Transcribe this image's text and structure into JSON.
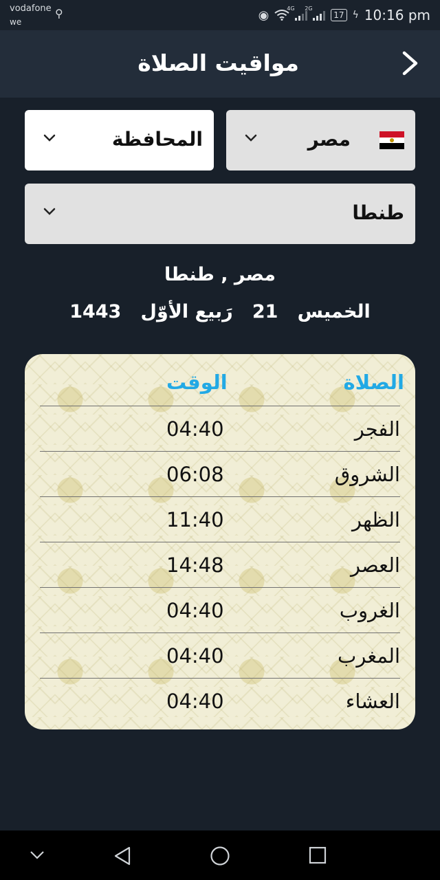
{
  "status": {
    "carrier": "vodafone",
    "carrier2": "we",
    "network1": "4G",
    "network2": "2G",
    "battery": "17",
    "time": "10:16 pm"
  },
  "header": {
    "title": "مواقيت الصلاة"
  },
  "filters": {
    "country": "مصر",
    "governorate_placeholder": "المحافظة",
    "city": "طنطا"
  },
  "location": {
    "place": "مصر , طنطا",
    "date_day": "الخميس",
    "date_num": "21",
    "date_month": "رَبيع الأوّل",
    "date_year": "1443"
  },
  "table": {
    "col_prayer": "الصلاة",
    "col_time": "الوقت",
    "rows": [
      {
        "prayer": "الفجر",
        "time": "04:40"
      },
      {
        "prayer": "الشروق",
        "time": "06:08"
      },
      {
        "prayer": "الظهر",
        "time": "11:40"
      },
      {
        "prayer": "العصر",
        "time": "14:48"
      },
      {
        "prayer": "الغروب",
        "time": "04:40"
      },
      {
        "prayer": "المغرب",
        "time": "04:40"
      },
      {
        "prayer": "العشاء",
        "time": "04:40"
      }
    ]
  },
  "colors": {
    "background": "#18202a",
    "header": "#232d3a",
    "accent": "#22a9e5"
  }
}
